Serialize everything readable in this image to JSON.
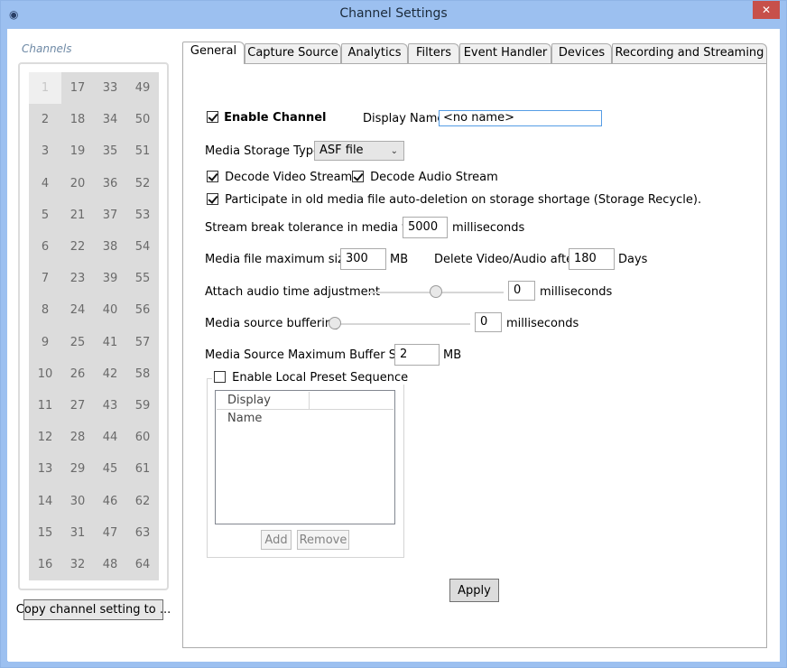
{
  "window": {
    "title": "Channel Settings",
    "close_glyph": "✕",
    "app_icon_glyph": "◉"
  },
  "channels": {
    "caption": "Channels",
    "selected": "1",
    "cells": [
      "1",
      "17",
      "33",
      "49",
      "2",
      "18",
      "34",
      "50",
      "3",
      "19",
      "35",
      "51",
      "4",
      "20",
      "36",
      "52",
      "5",
      "21",
      "37",
      "53",
      "6",
      "22",
      "38",
      "54",
      "7",
      "23",
      "39",
      "55",
      "8",
      "24",
      "40",
      "56",
      "9",
      "25",
      "41",
      "57",
      "10",
      "26",
      "42",
      "58",
      "11",
      "27",
      "43",
      "59",
      "12",
      "28",
      "44",
      "60",
      "13",
      "29",
      "45",
      "61",
      "14",
      "30",
      "46",
      "62",
      "15",
      "31",
      "47",
      "63",
      "16",
      "32",
      "48",
      "64"
    ],
    "copy_button": "Copy channel setting to ..."
  },
  "tabs": [
    "General",
    "Capture Source",
    "Analytics",
    "Filters",
    "Event Handler",
    "Devices",
    "Recording and Streaming"
  ],
  "general": {
    "enable_channel": "Enable Channel",
    "display_name_label": "Display Name",
    "display_name_value": "<no name>",
    "storage_type_label": "Media Storage Type",
    "storage_type_value": "ASF file",
    "decode_video": "Decode Video Stream",
    "decode_audio": "Decode Audio Stream",
    "recycle": "Participate in old media file auto-deletion on storage shortage (Storage Recycle).",
    "break_tolerance_label": "Stream break tolerance in media file :",
    "break_tolerance_value": "5000",
    "ms": "milliseconds",
    "max_size_label": "Media file maximum size:",
    "max_size_value": "300",
    "mb": "MB",
    "delete_after_label": "Delete Video/Audio after",
    "delete_after_value": "180",
    "days": "Days",
    "audio_adjust_label": "Attach audio time adjustment",
    "audio_adjust_value": "0",
    "audio_adjust_slider_fraction": 0.5,
    "buffering_label": "Media source buffering",
    "buffering_value": "0",
    "buffering_slider_fraction": 0.0,
    "max_buffer_label": "Media Source Maximum Buffer Size",
    "max_buffer_value": "2",
    "preset_label": "Enable Local Preset Sequence",
    "preset_column": "Display Name",
    "add_button": "Add",
    "remove_button": "Remove",
    "apply_button": "Apply"
  }
}
